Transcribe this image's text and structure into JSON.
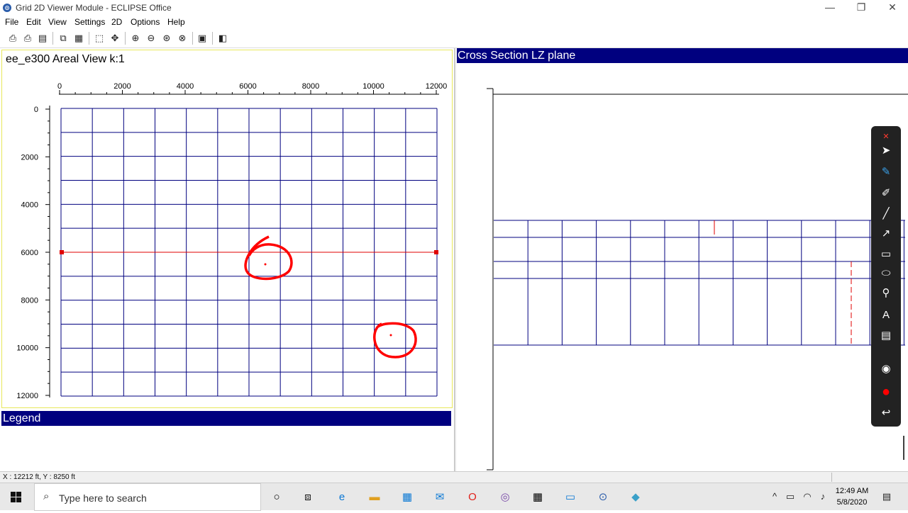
{
  "window": {
    "title": "Grid 2D Viewer Module - ECLIPSE Office",
    "minimize": "—",
    "restore": "❐",
    "close": "✕"
  },
  "menu": [
    "File",
    "Edit",
    "View",
    "Settings",
    "2D",
    "Options",
    "Help"
  ],
  "toolbar_icons": [
    "print-icon",
    "print-preview-icon",
    "page-setup-icon",
    "copy-icon",
    "paste-icon",
    "select-icon",
    "pan-icon",
    "zoom-in-icon",
    "zoom-out-icon",
    "zoom-fit-icon",
    "zoom-reset-icon",
    "properties-icon",
    "color-legend-icon"
  ],
  "areal": {
    "title": "ee_e300 Areal View k:1",
    "x_ticks": [
      "0",
      "2000",
      "4000",
      "6000",
      "8000",
      "10000",
      "12000"
    ],
    "y_ticks": [
      "0",
      "2000",
      "4000",
      "6000",
      "8000",
      "10000",
      "12000"
    ],
    "grid_color": "#00007f",
    "section_color": "#e00000",
    "annotation_color": "#ff0000"
  },
  "legend": {
    "title": "Legend"
  },
  "cross_section": {
    "title": "Cross Section LZ plane"
  },
  "status": {
    "coords": "X : 12212 ft, Y : 8250 ft"
  },
  "taskbar": {
    "search_placeholder": "Type here to search",
    "time": "12:49 AM",
    "date": "5/8/2020"
  },
  "colors": {
    "title_bar_blue": "#00007f",
    "ink_record": "#ff0000"
  }
}
